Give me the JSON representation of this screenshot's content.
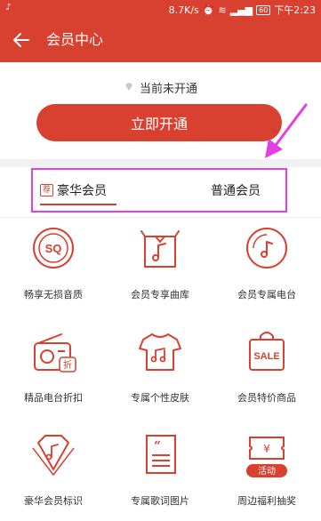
{
  "status_bar": {
    "network_speed": "8.7K/s",
    "battery": "60",
    "time": "下午2:23"
  },
  "app_bar": {
    "title": "会员中心"
  },
  "membership": {
    "status_text": "当前未开通",
    "open_button": "立即开通"
  },
  "tabs": {
    "luxury": {
      "tag": "荐",
      "label": "豪华会员"
    },
    "normal": {
      "label": "普通会员"
    }
  },
  "benefits": [
    {
      "label": "畅享无损音质",
      "icon": "sq-icon",
      "icon_text": "SQ"
    },
    {
      "label": "会员专享曲库",
      "icon": "music-box-icon"
    },
    {
      "label": "会员专属电台",
      "icon": "radio-disc-icon"
    },
    {
      "label": "精品电台折扣",
      "icon": "radio-discount-icon",
      "icon_text": "折"
    },
    {
      "label": "专属个性皮肤",
      "icon": "tshirt-icon"
    },
    {
      "label": "会员特价商品",
      "icon": "shopping-bag-icon",
      "icon_text": "SALE"
    },
    {
      "label": "豪华会员标识",
      "icon": "diamond-badge-icon"
    },
    {
      "label": "专属歌词图片",
      "icon": "lyrics-image-icon",
      "icon_text": "“"
    },
    {
      "label": "周边福利抽奖",
      "icon": "ticket-icon",
      "icon_text": "¥",
      "badge": "活动"
    }
  ],
  "colors": {
    "brand_red": "#d8402f",
    "highlight_magenta": "#e33fe2"
  }
}
